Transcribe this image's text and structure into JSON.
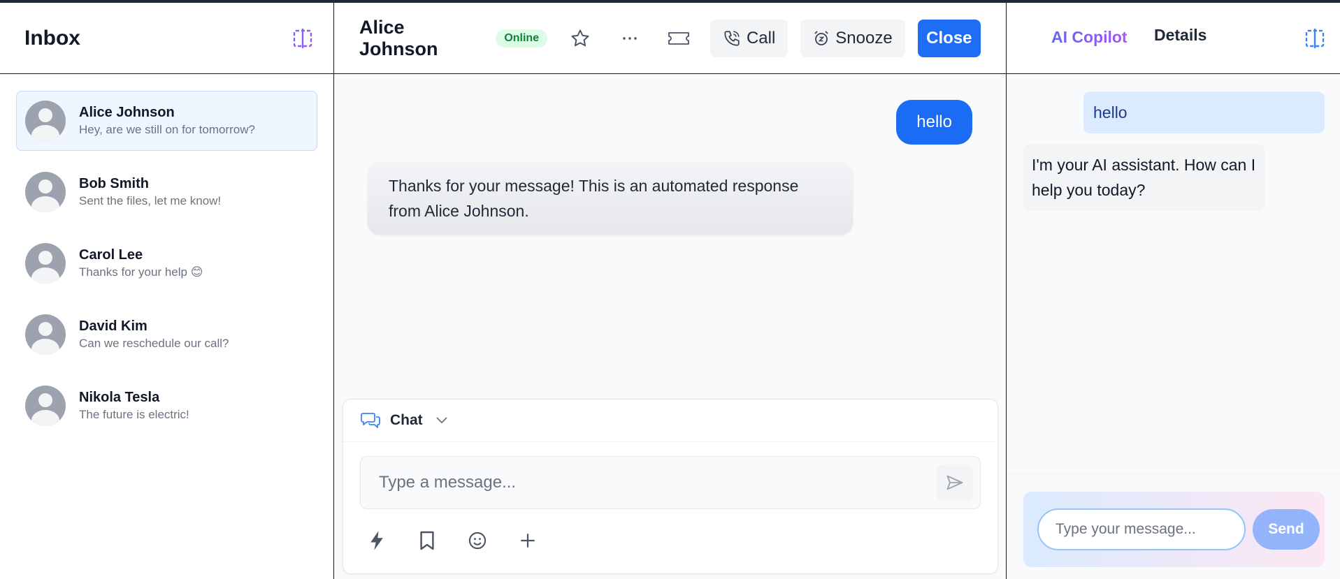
{
  "sidebar": {
    "title": "Inbox",
    "conversations": [
      {
        "name": "Alice Johnson",
        "preview": "Hey, are we still on for tomorrow?",
        "active": true
      },
      {
        "name": "Bob Smith",
        "preview": "Sent the files, let me know!"
      },
      {
        "name": "Carol Lee",
        "preview": "Thanks for your help 😊"
      },
      {
        "name": "David Kim",
        "preview": "Can we reschedule our call?"
      },
      {
        "name": "Nikola Tesla",
        "preview": "The future is electric!"
      }
    ]
  },
  "header": {
    "contact_name": "Alice Johnson",
    "status": "Online",
    "call_label": "Call",
    "snooze_label": "Snooze",
    "close_label": "Close"
  },
  "messages": [
    {
      "direction": "outgoing",
      "text": "hello"
    },
    {
      "direction": "incoming",
      "text": "Thanks for your message! This is an automated response from Alice Johnson."
    }
  ],
  "composer": {
    "channel": "Chat",
    "placeholder": "Type a message..."
  },
  "right_panel": {
    "tabs": [
      "AI Copilot",
      "Details"
    ],
    "active_tab": "AI Copilot",
    "messages": [
      {
        "role": "user",
        "text": "hello"
      },
      {
        "role": "assistant",
        "text": "I'm your AI assistant. How can I help you today?"
      }
    ],
    "input_placeholder": "Type your message...",
    "send_label": "Send"
  },
  "colors": {
    "primary": "#1d6ef5",
    "online_bg": "#dcfce7",
    "online_text": "#15803d",
    "active_conversation_bg": "#eff6ff",
    "ai_accent": "#8b5cf6"
  }
}
